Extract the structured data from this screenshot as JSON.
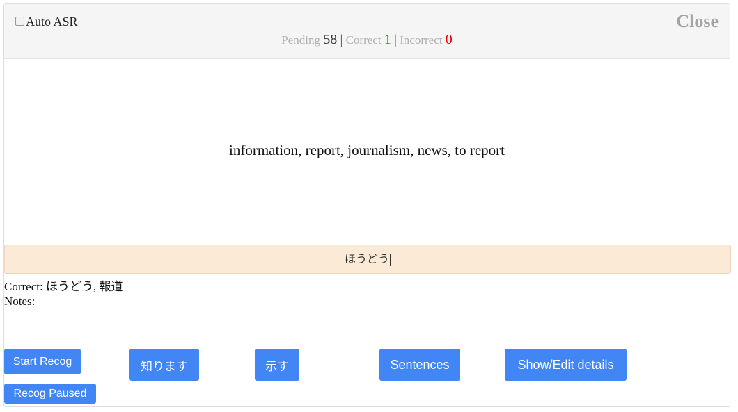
{
  "header": {
    "auto_asr_label": "Auto ASR",
    "auto_asr_checked": false,
    "close_label": "Close",
    "stats": {
      "pending_label": "Pending",
      "pending_value": "58",
      "correct_label": "Correct",
      "correct_value": "1",
      "incorrect_label": "Incorrect",
      "incorrect_value": "0",
      "separator": "|"
    }
  },
  "prompt_text": "information, report, journalism, news, to report",
  "answer_input_value": "ほうどう",
  "feedback": {
    "correct_text": "Correct: ほうどう, 報道",
    "notes_text": "Notes:"
  },
  "buttons": {
    "start_recog": "Start Recog",
    "recog_paused": "Recog Paused",
    "kanji_option_1": "知ります",
    "kanji_option_2": "示す",
    "sentences": "Sentences",
    "show_edit_details": "Show/Edit details"
  },
  "colors": {
    "button_blue": "#4285f4",
    "correct_green": "#1f8f1f",
    "incorrect_red": "#e00000",
    "answer_bg": "#fbead6"
  }
}
